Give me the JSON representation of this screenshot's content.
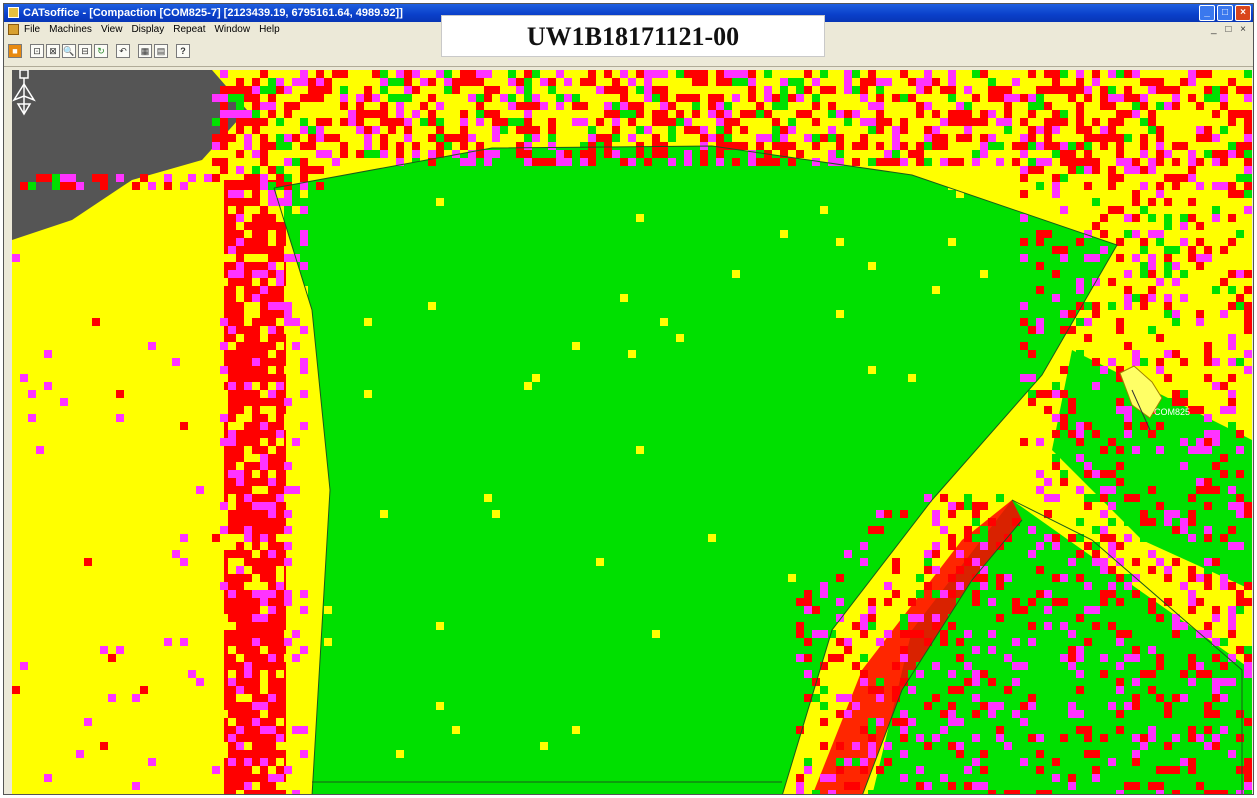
{
  "window": {
    "title": "CATsoffice - [Compaction [COM825-7]   [2123439.19, 6795161.64, 4989.92]]",
    "buttons": {
      "minimize": "_",
      "maximize": "□",
      "close": "×"
    },
    "mdi_buttons": "_ □ ×"
  },
  "menubar": {
    "items": [
      {
        "label": "File"
      },
      {
        "label": "Machines"
      },
      {
        "label": "View"
      },
      {
        "label": "Display"
      },
      {
        "label": "Repeat"
      },
      {
        "label": "Window"
      },
      {
        "label": "Help"
      }
    ]
  },
  "toolbar": {
    "tools": [
      {
        "icon": "stop-icon",
        "glyph": "■"
      },
      {
        "icon": "zoom-window-icon",
        "glyph": "⊡"
      },
      {
        "icon": "zoom-extents-icon",
        "glyph": "⊠"
      },
      {
        "icon": "zoom-in-icon",
        "glyph": "🔍"
      },
      {
        "icon": "zoom-out-icon",
        "glyph": "⊟"
      },
      {
        "icon": "rotate-icon",
        "glyph": "↻"
      },
      {
        "icon": "undo-icon",
        "glyph": "↶"
      },
      {
        "icon": "table-icon",
        "glyph": "▦"
      },
      {
        "icon": "layers-icon",
        "glyph": "▤"
      },
      {
        "icon": "help-icon",
        "glyph": "?"
      }
    ]
  },
  "banner": {
    "text": "UW1B18171121-00"
  },
  "map": {
    "machine_label": "COM825",
    "colors": {
      "yellow": "#ffff00",
      "green": "#00e000",
      "red": "#ff0000",
      "magenta": "#ff33ff",
      "gray": "#555555"
    }
  }
}
